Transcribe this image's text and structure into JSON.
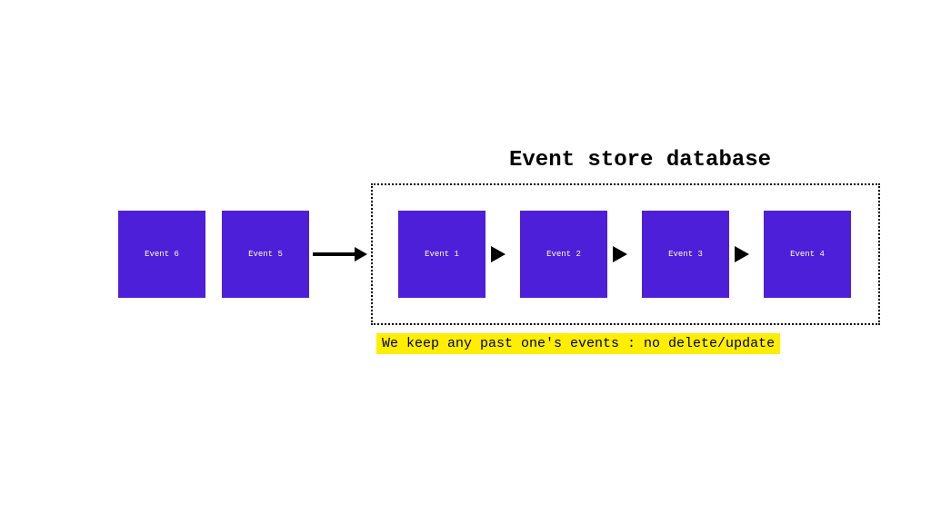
{
  "title": "Event store database",
  "annotation": "We keep any past one's events : no delete/update",
  "outside_events": [
    {
      "label": "Event 6"
    },
    {
      "label": "Event 5"
    }
  ],
  "stored_events": [
    {
      "label": "Event 1"
    },
    {
      "label": "Event 2"
    },
    {
      "label": "Event 3"
    },
    {
      "label": "Event 4"
    }
  ]
}
